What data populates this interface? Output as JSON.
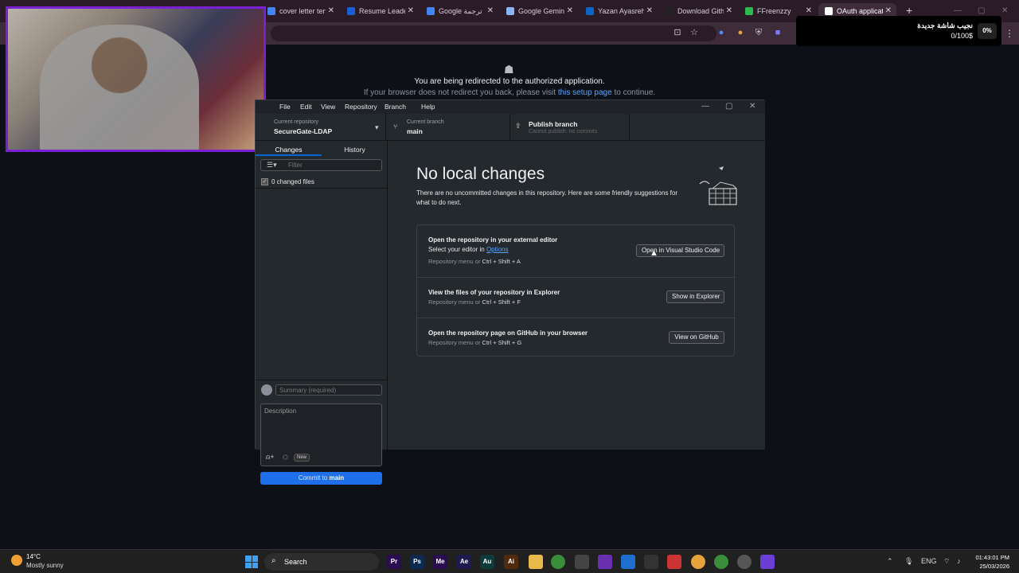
{
  "browser": {
    "tabs": [
      {
        "label": "cover letter ten",
        "color": "#4285f4"
      },
      {
        "label": "Resume Leader",
        "color": "#1a5fd6"
      },
      {
        "label": "Google ترجمة",
        "color": "#4285f4"
      },
      {
        "label": "Google Gemini",
        "color": "#8ab4f8"
      },
      {
        "label": "Yazan Ayasreh",
        "color": "#0a66c2"
      },
      {
        "label": "Download Gith",
        "color": "#222222"
      },
      {
        "label": "FFreenzzy",
        "color": "#2dba4e"
      },
      {
        "label": "OAuth applicat",
        "color": "#ffffff"
      }
    ],
    "close_glyph": "✕",
    "new_tab": "+",
    "redirect_title": "You are being redirected to the authorized application.",
    "redirect_prefix": "If your browser does not redirect you back, please visit",
    "redirect_link": "this setup page",
    "redirect_suffix": "to continue."
  },
  "notification": {
    "title": "نجيب شاشة جديدة",
    "subtitle": "0/100$",
    "percent": "0%"
  },
  "app": {
    "menu": [
      "File",
      "Edit",
      "View",
      "Repository",
      "Branch",
      "Help"
    ],
    "repo_label": "Current repository",
    "repo_name": "SecureGate-LDAP",
    "branch_label": "Current branch",
    "branch_name": "main",
    "publish_label": "Publish branch",
    "publish_sub": "Cannot publish: no commits",
    "tabs": [
      "Changes",
      "History"
    ],
    "filter_placeholder": "Filter",
    "changed_files": "0 changed files",
    "summary_placeholder": "Summary (required)",
    "description_placeholder": "Description",
    "new_badge": "New",
    "commit_prefix": "Commit to",
    "commit_branch": "main"
  },
  "main": {
    "title": "No local changes",
    "description": "There are no uncommitted changes in this repository. Here are some friendly suggestions for what to do next.",
    "suggestions": [
      {
        "title": "Open the repository in your external editor",
        "sub_prefix": "Select your editor in",
        "sub_link": "Options",
        "hint_prefix": "Repository menu or",
        "shortcut": "Ctrl + Shift + A",
        "button": "Open in Visual Studio Code"
      },
      {
        "title": "View the files of your repository in Explorer",
        "hint_prefix": "Repository menu or",
        "shortcut": "Ctrl + Shift + F",
        "button": "Show in Explorer"
      },
      {
        "title": "Open the repository page on GitHub in your browser",
        "hint_prefix": "Repository menu or",
        "shortcut": "Ctrl + Shift + G",
        "button": "View on GitHub"
      }
    ]
  },
  "taskbar": {
    "weather_temp": "14°C",
    "weather_desc": "Mostly sunny",
    "search_label": "Search",
    "apps": [
      {
        "label": "Pr",
        "color": "#2a0d4f"
      },
      {
        "label": "Ps",
        "color": "#0c2a4f"
      },
      {
        "label": "Me",
        "color": "#2a0d4f"
      },
      {
        "label": "Ae",
        "color": "#1f1a4f"
      },
      {
        "label": "Au",
        "color": "#0d3a3a"
      },
      {
        "label": "Ai",
        "color": "#4f2a0d"
      }
    ],
    "lang": "ENG",
    "time": "01:43:01 PM",
    "date": "25/03/2026"
  }
}
